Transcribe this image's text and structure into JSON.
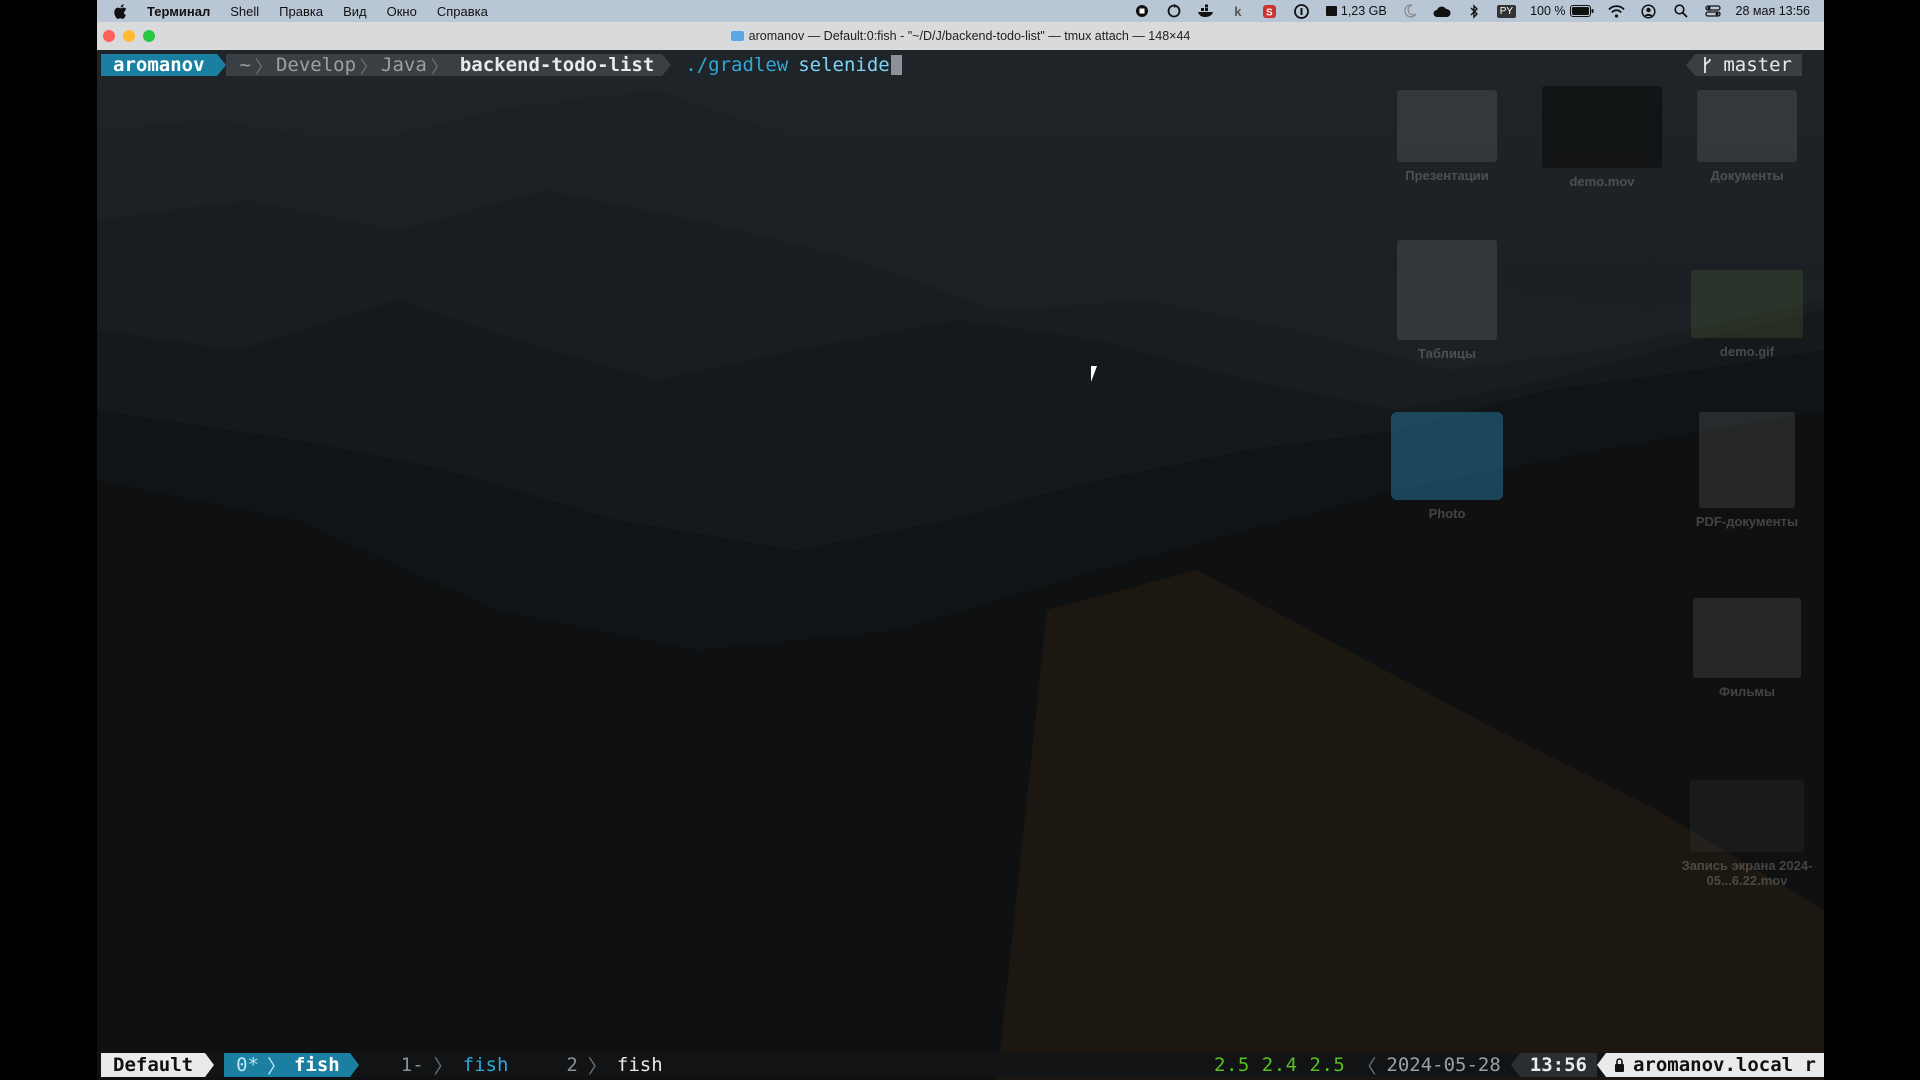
{
  "menubar": {
    "app_name": "Терминал",
    "menus": [
      "Shell",
      "Правка",
      "Вид",
      "Окно",
      "Справка"
    ],
    "memory": "1,23 GB",
    "input_source": "PY",
    "battery": "100 %",
    "datetime": "28 мая  13:56"
  },
  "window": {
    "title": "aromanov — Default:0:fish - \"~/D/J/backend-todo-list\" — tmux attach — 148×44"
  },
  "prompt": {
    "user": "aromanov",
    "path": [
      "~",
      "Develop",
      "Java"
    ],
    "current_dir": "backend-todo-list",
    "command": "./gradlew",
    "argument": "selenide",
    "git_branch": "master",
    "git_icon": "branch-icon"
  },
  "desktop": {
    "icons": [
      {
        "label": "Презентации"
      },
      {
        "label": "demo.mov"
      },
      {
        "label": "Документы"
      },
      {
        "label": "Таблицы"
      },
      {
        "label": "demo.gif"
      },
      {
        "label": "Photo"
      },
      {
        "label": "PDF-документы"
      },
      {
        "label": "Фильмы"
      },
      {
        "label": "Запись экрана 2024-05...6.22.mov"
      }
    ]
  },
  "tmux": {
    "session": "Default",
    "current_window_index": "0*",
    "current_window_name": "fish",
    "windows": [
      {
        "index": "1-",
        "name": "fish"
      },
      {
        "index": "2",
        "name": "fish"
      }
    ],
    "load": "2.5 2.4 2.5",
    "date": "2024-05-28",
    "time": "13:56",
    "host": "aromanov.local r"
  },
  "colors": {
    "accent": "#1a7fa0",
    "load": "#58c020",
    "menubar": "#b9c6d6"
  }
}
